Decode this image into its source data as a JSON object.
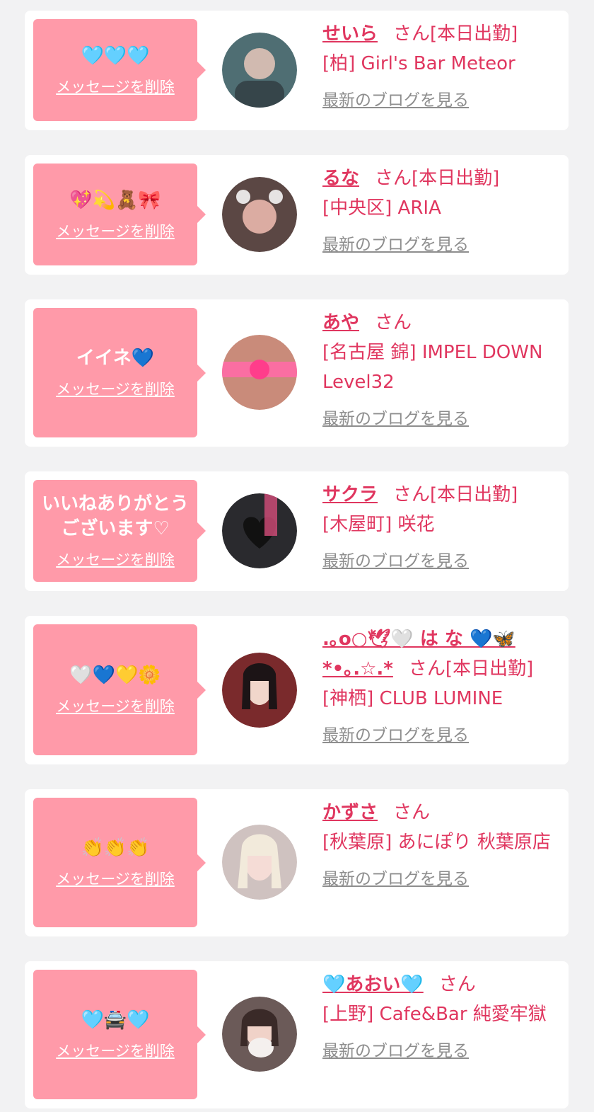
{
  "delete_label": "メッセージを削除",
  "blog_label": "最新のブログを見る",
  "san_label": "さん",
  "items": [
    {
      "message": "🩵🩵🩵",
      "name": "せいら",
      "status": "[本日出勤]",
      "shop": "[柏] Girl's Bar Meteor",
      "avatar_color": "#4f6e73"
    },
    {
      "message": "💖💫🧸🎀",
      "name": "るな",
      "status": "[本日出勤]",
      "shop": "[中央区] ARIA",
      "avatar_color": "#5b4744"
    },
    {
      "message": "イイネ💙",
      "name": "あや",
      "status": "",
      "shop": "[名古屋 錦] IMPEL DOWN Level32",
      "avatar_color": "#c98b7a"
    },
    {
      "message": "いいねありがとうございます♡",
      "name": "サクラ",
      "status": "[本日出勤]",
      "shop": "[木屋町] 咲花",
      "avatar_color": "#2a2a2e"
    },
    {
      "message": "🤍💙💛🌼",
      "name": ".｡o○🕊🤍 は な 💙🦋 *•｡.☆.*",
      "status": "[本日出勤]",
      "shop": "[神栖] CLUB LUMINE",
      "avatar_color": "#7a2a2c"
    },
    {
      "message": "👏👏👏",
      "name": "かずさ",
      "status": "",
      "shop": "[秋葉原] あにぽり 秋葉原店",
      "avatar_color": "#cfc2c0"
    },
    {
      "message": "🩵🚔🩵",
      "name": "🩵あおい🩵",
      "status": "",
      "shop": "[上野] Cafe&Bar 純愛牢獄",
      "avatar_color": "#6b5a58"
    }
  ]
}
